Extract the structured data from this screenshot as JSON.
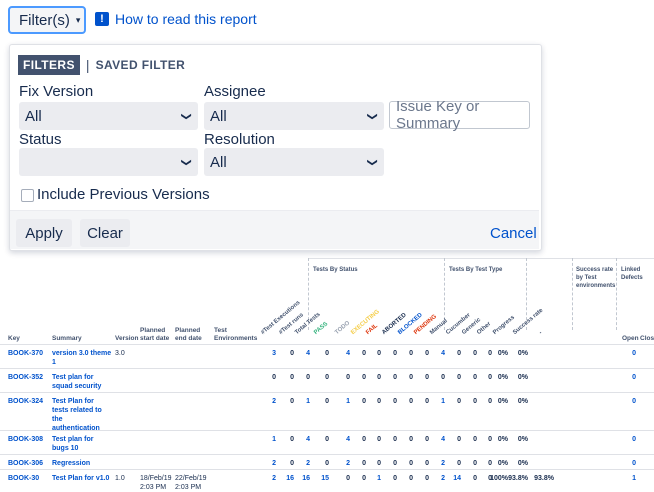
{
  "top": {
    "filter_button": "Filter(s)",
    "filter_caret": "▾",
    "help_link": "How to read this report",
    "help_icon": "!"
  },
  "panel": {
    "tab_filters": "FILTERS",
    "tab_separator": "|",
    "tab_saved": "SAVED FILTER",
    "fix_version_label": "Fix Version",
    "fix_version_value": "All",
    "assignee_label": "Assignee",
    "assignee_value": "All",
    "search_placeholder": "Issue Key or Summary",
    "status_label": "Status",
    "status_value": "",
    "resolution_label": "Resolution",
    "resolution_value": "All",
    "include_previous": "Include Previous Versions",
    "apply": "Apply",
    "clear": "Clear",
    "cancel": "Cancel",
    "chevron": "❯"
  },
  "table": {
    "group_status": "Tests By Status",
    "group_type": "Tests By Test Type",
    "group_success": "Success rate by Test environments",
    "group_linked": "Linked Defects",
    "columns": {
      "key": "Key",
      "summary": "Summary",
      "version": "Version",
      "planned_start": "Planned start date",
      "planned_end": "Planned end date",
      "test_env": "Test Environments",
      "open": "Open",
      "closed": "Clos"
    },
    "rotated": [
      {
        "label": "#Test Executions",
        "color": "#42526e"
      },
      {
        "label": "#Test runs",
        "color": "#42526e"
      },
      {
        "label": "Total Tests",
        "color": "#42526e"
      },
      {
        "label": "PASS",
        "color": "#36b37e"
      },
      {
        "label": "TODO",
        "color": "#97a0af"
      },
      {
        "label": "EXECUTING",
        "color": "#f5cd47"
      },
      {
        "label": "FAIL",
        "color": "#de350b"
      },
      {
        "label": "ABORTED",
        "color": "#172b4d"
      },
      {
        "label": "BLOCKED",
        "color": "#0052cc"
      },
      {
        "label": "PENDING",
        "color": "#de350b"
      },
      {
        "label": "Manual",
        "color": "#42526e"
      },
      {
        "label": "Cucumber",
        "color": "#42526e"
      },
      {
        "label": "Generic",
        "color": "#42526e"
      },
      {
        "label": "Other",
        "color": "#42526e"
      },
      {
        "label": "Progress",
        "color": "#42526e"
      },
      {
        "label": "Success rate",
        "color": "#42526e"
      },
      {
        "label": "-",
        "color": "#42526e"
      }
    ],
    "rows": [
      {
        "key": "BOOK-370",
        "summary": "version 3.0 theme 1",
        "version": "3.0",
        "start": "",
        "end": "",
        "vals": [
          "3",
          "0",
          "4",
          "0",
          "4",
          "0",
          "0",
          "0",
          "0",
          "0",
          "4",
          "0",
          "0",
          "0",
          "0%",
          "0%",
          ""
        ],
        "open": "0"
      },
      {
        "key": "BOOK-352",
        "summary": "Test plan for squad security",
        "version": "",
        "start": "",
        "end": "",
        "vals": [
          "0",
          "0",
          "0",
          "0",
          "0",
          "0",
          "0",
          "0",
          "0",
          "0",
          "0",
          "0",
          "0",
          "0",
          "0%",
          "0%",
          ""
        ],
        "open": "0"
      },
      {
        "key": "BOOK-324",
        "summary": "Test Plan for tests related to the authentication",
        "version": "",
        "start": "",
        "end": "",
        "vals": [
          "2",
          "0",
          "1",
          "0",
          "1",
          "0",
          "0",
          "0",
          "0",
          "0",
          "1",
          "0",
          "0",
          "0",
          "0%",
          "0%",
          ""
        ],
        "open": "0"
      },
      {
        "key": "BOOK-308",
        "summary": "Test plan for bugs 10",
        "version": "",
        "start": "",
        "end": "",
        "vals": [
          "1",
          "0",
          "4",
          "0",
          "4",
          "0",
          "0",
          "0",
          "0",
          "0",
          "4",
          "0",
          "0",
          "0",
          "0%",
          "0%",
          ""
        ],
        "open": "0"
      },
      {
        "key": "BOOK-306",
        "summary": "Regression",
        "version": "",
        "start": "",
        "end": "",
        "vals": [
          "2",
          "0",
          "2",
          "0",
          "2",
          "0",
          "0",
          "0",
          "0",
          "0",
          "2",
          "0",
          "0",
          "0",
          "0%",
          "0%",
          ""
        ],
        "open": "0"
      },
      {
        "key": "BOOK-30",
        "summary": "Test Plan for v1.0",
        "version": "1.0",
        "start": "18/Feb/19 2:03 PM",
        "end": "22/Feb/19 2:03 PM",
        "vals": [
          "2",
          "16",
          "16",
          "15",
          "0",
          "0",
          "1",
          "0",
          "0",
          "0",
          "2",
          "14",
          "0",
          "0",
          "100%",
          "93.8%",
          "93.8%"
        ],
        "open": "1"
      }
    ]
  }
}
